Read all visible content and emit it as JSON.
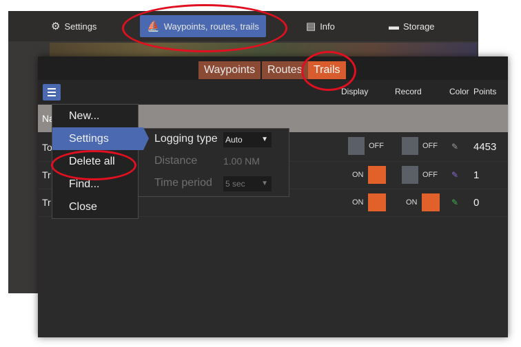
{
  "top_tabs": [
    {
      "icon": "gear-icon",
      "label": "Settings",
      "active": false
    },
    {
      "icon": "waypoint-icon",
      "label": "Waypoints, routes, trails",
      "active": true
    },
    {
      "icon": "info-icon",
      "label": "Info",
      "active": false
    },
    {
      "icon": "folder-icon",
      "label": "Storage",
      "active": false
    }
  ],
  "sub_tabs": [
    {
      "label": "Waypoints",
      "active": false
    },
    {
      "label": "Routes",
      "active": false
    },
    {
      "label": "Trails",
      "active": true
    }
  ],
  "columns": {
    "display": "Display",
    "record": "Record",
    "color": "Color",
    "points": "Points"
  },
  "selected_row_name": "Na",
  "rows": [
    {
      "name": "To",
      "display": "OFF",
      "record": "OFF",
      "color": "#9a9a9a",
      "points": "4453"
    },
    {
      "name": "Tr",
      "display": "ON",
      "record": "OFF",
      "color": "#8a6ad0",
      "points": "1"
    },
    {
      "name": "Tr",
      "display": "ON",
      "record": "ON",
      "color": "#3fb34a",
      "points": "0"
    }
  ],
  "menu": {
    "items": [
      "New...",
      "Settings",
      "Delete all",
      "Find...",
      "Close"
    ],
    "active_index": 1
  },
  "settings_submenu": {
    "logging_type_label": "Logging type",
    "logging_type_value": "Auto",
    "distance_label": "Distance",
    "distance_value": "1.00 NM",
    "time_period_label": "Time period",
    "time_period_value": "5 sec"
  },
  "colors": {
    "accent": "#4a69b0",
    "orange": "#d95c2e",
    "annotation": "#e01020"
  }
}
